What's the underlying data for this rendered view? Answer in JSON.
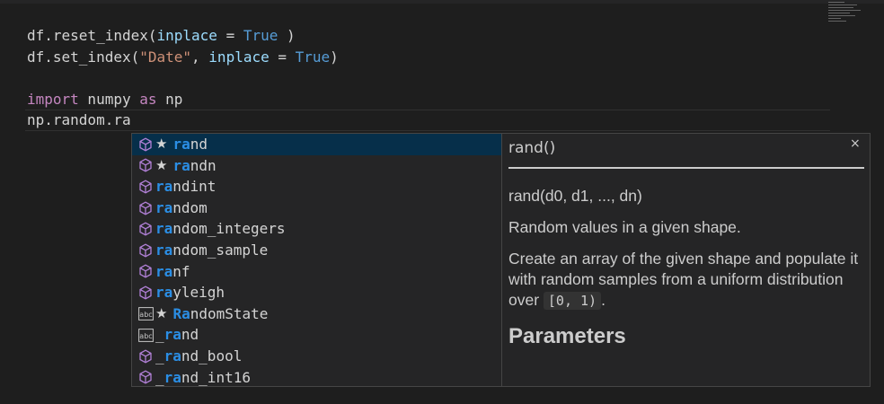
{
  "editor": {
    "lines": [
      [
        {
          "t": "df.reset_index(",
          "c": "t-default"
        },
        {
          "t": "inplace",
          "c": "t-param"
        },
        {
          "t": " = ",
          "c": "t-default"
        },
        {
          "t": "True",
          "c": "t-const"
        },
        {
          "t": " )",
          "c": "t-default"
        }
      ],
      [
        {
          "t": "df.set_index(",
          "c": "t-default"
        },
        {
          "t": "\"Date\"",
          "c": "t-str"
        },
        {
          "t": ", ",
          "c": "t-default"
        },
        {
          "t": "inplace",
          "c": "t-param"
        },
        {
          "t": " = ",
          "c": "t-default"
        },
        {
          "t": "True",
          "c": "t-const"
        },
        {
          "t": ")",
          "c": "t-default"
        }
      ],
      [],
      [
        {
          "t": "import",
          "c": "t-kw"
        },
        {
          "t": " numpy ",
          "c": "t-default"
        },
        {
          "t": "as",
          "c": "t-kw"
        },
        {
          "t": " np",
          "c": "t-default"
        }
      ],
      [
        {
          "t": "np.random.ra",
          "c": "t-default"
        }
      ]
    ]
  },
  "suggestions": [
    {
      "kind": "cube-icon",
      "starred": true,
      "match": "ra",
      "rest": "nd",
      "prefix": "",
      "selected": true
    },
    {
      "kind": "cube-icon",
      "starred": true,
      "match": "ra",
      "rest": "ndn",
      "prefix": ""
    },
    {
      "kind": "cube-icon",
      "starred": false,
      "match": "ra",
      "rest": "ndint",
      "prefix": ""
    },
    {
      "kind": "cube-icon",
      "starred": false,
      "match": "ra",
      "rest": "ndom",
      "prefix": ""
    },
    {
      "kind": "cube-icon",
      "starred": false,
      "match": "ra",
      "rest": "ndom_integers",
      "prefix": ""
    },
    {
      "kind": "cube-icon",
      "starred": false,
      "match": "ra",
      "rest": "ndom_sample",
      "prefix": ""
    },
    {
      "kind": "cube-icon",
      "starred": false,
      "match": "ra",
      "rest": "nf",
      "prefix": ""
    },
    {
      "kind": "cube-icon",
      "starred": false,
      "match": "ra",
      "rest": "yleigh",
      "prefix": ""
    },
    {
      "kind": "text-icon",
      "starred": true,
      "match": "Ra",
      "rest": "ndomState",
      "prefix": ""
    },
    {
      "kind": "text-icon",
      "starred": false,
      "match": "ra",
      "rest": "nd",
      "prefix": "_"
    },
    {
      "kind": "cube-icon",
      "starred": false,
      "match": "ra",
      "rest": "nd_bool",
      "prefix": "_"
    },
    {
      "kind": "cube-icon",
      "starred": false,
      "match": "ra",
      "rest": "nd_int16",
      "prefix": "_"
    }
  ],
  "docs": {
    "signature": "rand()",
    "close": "×",
    "call": "rand(d0, d1, ..., dn)",
    "summary": "Random values in a given shape.",
    "desc_before": "Create an array of the given shape and populate it with random samples from a uniform distribution over ",
    "desc_code": "[0, 1)",
    "desc_after": ".",
    "heading": "Parameters"
  },
  "colors": {
    "match": "#2b8ee5",
    "selected_bg": "#062f4a",
    "cube": "#b180d7"
  }
}
